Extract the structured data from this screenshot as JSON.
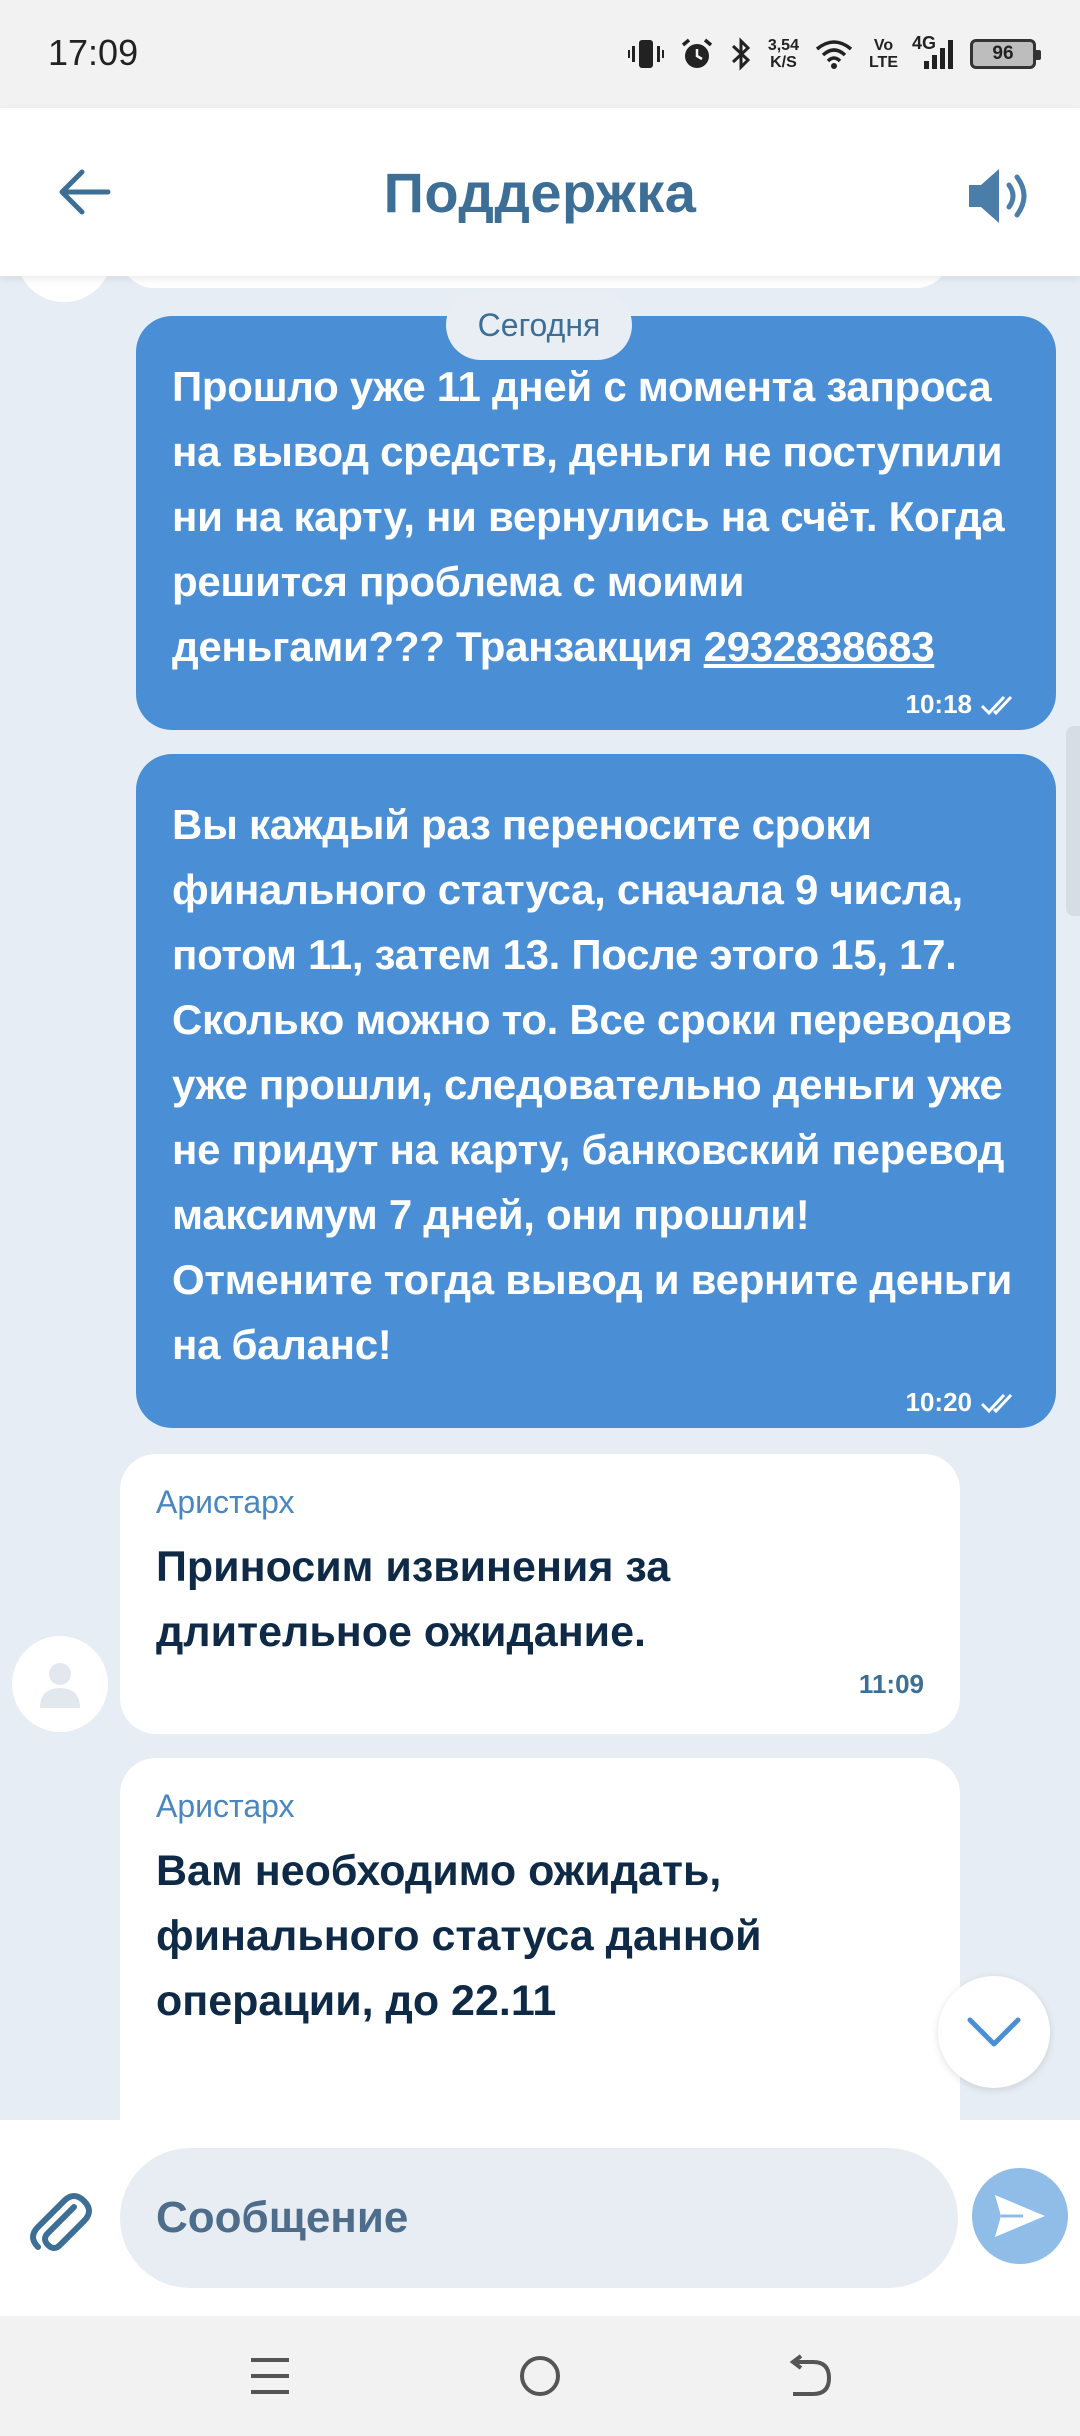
{
  "status_bar": {
    "time": "17:09",
    "net_speed_value": "3,54",
    "net_speed_unit": "K/S",
    "volte_top": "Vo",
    "volte_bottom": "LTE",
    "network": "4G",
    "battery": "96",
    "icons": [
      "vibrate-icon",
      "alarm-icon",
      "bluetooth-icon",
      "wifi-icon",
      "signal-icon",
      "battery-icon"
    ]
  },
  "header": {
    "title": "Поддержка",
    "back_icon": "arrow-left-icon",
    "sound_icon": "speaker-icon"
  },
  "chat": {
    "date_label": "Сегодня",
    "messages": [
      {
        "direction": "outgoing",
        "text": "Прошло уже 11 дней с момента запроса на вывод средств, деньги не поступили ни на карту, ни вернулись на счёт. Когда решится проблема с моими деньгами???",
        "text_suffix_label": "Транзакция",
        "link": "2932838683",
        "time": "10:18",
        "status": "read"
      },
      {
        "direction": "outgoing",
        "text": "Вы каждый раз переносите сроки финального статуса, сначала 9 числа, потом 11, затем 13. После этого 15, 17. Сколько можно то. Все сроки переводов уже прошли, следовательно деньги уже не придут на карту, банковский перевод максимум 7 дней, они прошли! Отмените тогда вывод и верните деньги на баланс!",
        "time": "10:20",
        "status": "read"
      },
      {
        "direction": "incoming",
        "sender": "Аристарх",
        "text": "Приносим извинения за длительное ожидание.",
        "time": "11:09"
      },
      {
        "direction": "incoming",
        "sender": "Аристарх",
        "text": "Вам необходимо ожидать, финального статуса данной операции, до 22.11",
        "time": ""
      }
    ]
  },
  "input": {
    "placeholder": "Сообщение",
    "attach_icon": "paperclip-icon",
    "send_icon": "send-icon"
  },
  "nav": {
    "icons": [
      "menu-icon",
      "home-icon",
      "back-icon"
    ]
  },
  "colors": {
    "accent": "#4a8fd6",
    "header_text": "#3d6e95",
    "background": "#e7edf4"
  }
}
